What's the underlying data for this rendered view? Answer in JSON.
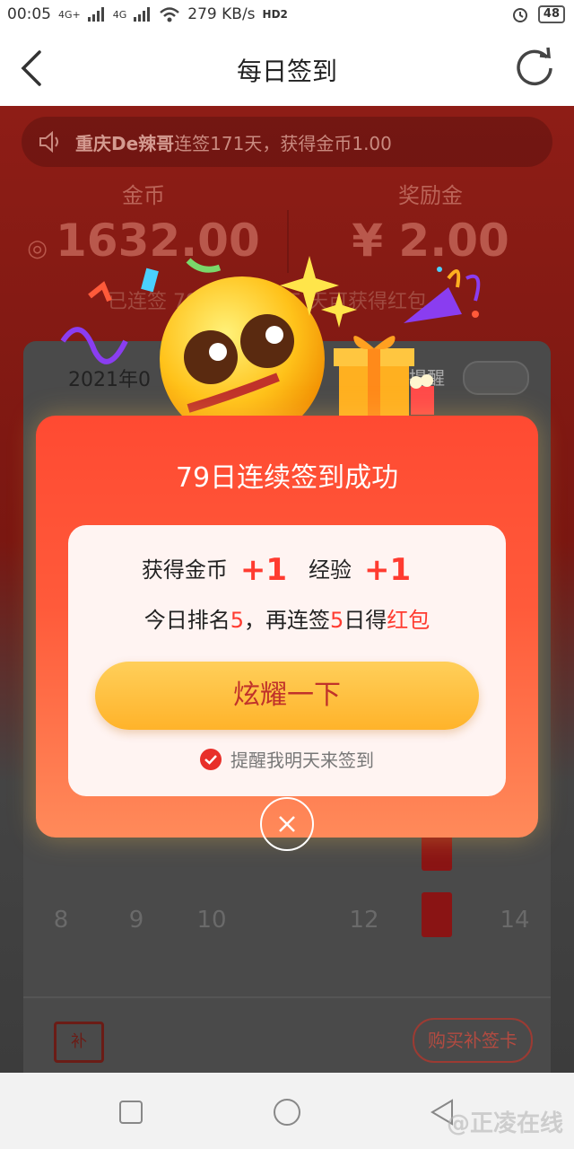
{
  "status_bar": {
    "time": "00:05",
    "signal1": "4G+",
    "signal2": "4G",
    "speed": "279 KB/s",
    "hd": "HD2",
    "battery": "48"
  },
  "nav": {
    "title": "每日签到"
  },
  "marquee": {
    "user": "重庆De辣哥",
    "text": "连签171天，获得金币1.00"
  },
  "stats": {
    "coins_label": "金币",
    "coins_value": "1632.00",
    "bonus_label": "奖励金",
    "bonus_value": "¥ 2.00"
  },
  "hint_text": "已连签 79 天，再签 5 天可获得红包",
  "calendar": {
    "month": "2021年0",
    "remind_label": "提醒",
    "days": [
      "8",
      "9",
      "10",
      "12",
      "14"
    ],
    "buy_label": "购买补签卡",
    "ticket_label": "补"
  },
  "popup": {
    "title": "79日连续签到成功",
    "coin_label": "获得金币",
    "coin_plus": "+1",
    "exp_label": "经验",
    "exp_plus": "+1",
    "rank_prefix": "今日排名",
    "rank_num": "5",
    "rank_mid": "，再连签",
    "rank_days": "5",
    "rank_suffix": "日得",
    "rank_reward": "红包",
    "button": "炫耀一下",
    "remind_text": "提醒我明天来签到"
  },
  "watermark": "@正凌在线",
  "colors": {
    "accent": "#ff3b30",
    "button": "#ffbf3a",
    "popup": "#ff5a3a"
  }
}
